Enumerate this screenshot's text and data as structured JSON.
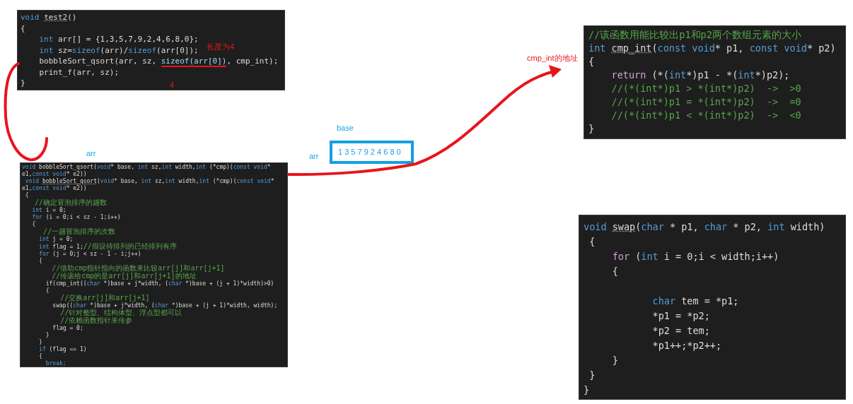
{
  "snippets": [
    {
      "lines": [
        {
          "tokens": [
            {
              "text": "void ",
              "kind": "kw"
            },
            {
              "text": "test2",
              "kind": "def"
            },
            {
              "text": "()",
              "kind": "pl"
            }
          ]
        },
        {
          "tokens": [
            {
              "text": "{",
              "kind": "pl"
            }
          ]
        },
        {
          "tokens": [
            {
              "text": "    int ",
              "kind": "kw"
            },
            {
              "text": "arr[] = {1,3,5,7,9,2,4,6,8,0};",
              "kind": "pl"
            }
          ]
        },
        {
          "tokens": [
            {
              "text": "    int ",
              "kind": "kw"
            },
            {
              "text": "sz=",
              "kind": "pl"
            },
            {
              "text": "sizeof",
              "kind": "kw"
            },
            {
              "text": "(arr)/",
              "kind": "pl"
            },
            {
              "text": "sizeof",
              "kind": "kw"
            },
            {
              "text": "(arr[0]);",
              "kind": "pl"
            }
          ]
        },
        {
          "tokens": [
            {
              "text": "    bobbleSort_qsort(arr, sz, ",
              "kind": "pl"
            },
            {
              "text": "sizeof(arr[0])",
              "kind": "mark"
            },
            {
              "text": ", cmp_int);",
              "kind": "pl"
            }
          ]
        },
        {
          "tokens": [
            {
              "text": "    print_f(arr, sz);",
              "kind": "pl"
            }
          ]
        },
        {
          "tokens": [
            {
              "text": "}",
              "kind": "pl"
            }
          ]
        }
      ]
    },
    {
      "lines": [
        {
          "tokens": [
            {
              "text": "void ",
              "kind": "kw"
            },
            {
              "text": "bobbleSort_qsort(",
              "kind": "pl"
            },
            {
              "text": "void",
              "kind": "kw"
            },
            {
              "text": "* base, ",
              "kind": "pl"
            },
            {
              "text": "int ",
              "kind": "kw"
            },
            {
              "text": "sz,",
              "kind": "pl"
            },
            {
              "text": "int ",
              "kind": "kw"
            },
            {
              "text": "width,",
              "kind": "pl"
            },
            {
              "text": "int ",
              "kind": "kw"
            },
            {
              "text": "(*cmp)(",
              "kind": "pl"
            },
            {
              "text": "const void",
              "kind": "kw"
            },
            {
              "text": "* e1,",
              "kind": "pl"
            },
            {
              "text": "const void",
              "kind": "kw"
            },
            {
              "text": "* e2))",
              "kind": "pl"
            }
          ]
        },
        {
          "tokens": [
            {
              "text": " void ",
              "kind": "kw"
            },
            {
              "text": "bobbleSort_qsort",
              "kind": "def"
            },
            {
              "text": "(",
              "kind": "pl"
            },
            {
              "text": "void",
              "kind": "kw"
            },
            {
              "text": "* base, ",
              "kind": "pl"
            },
            {
              "text": "int ",
              "kind": "kw"
            },
            {
              "text": "sz,",
              "kind": "pl"
            },
            {
              "text": "int ",
              "kind": "kw"
            },
            {
              "text": "width,",
              "kind": "pl"
            },
            {
              "text": "int ",
              "kind": "kw"
            },
            {
              "text": "(*cmp)(",
              "kind": "pl"
            },
            {
              "text": "const void",
              "kind": "kw"
            },
            {
              "text": "* e1,",
              "kind": "pl"
            },
            {
              "text": "const void",
              "kind": "kw"
            },
            {
              "text": "* e2))",
              "kind": "pl"
            }
          ]
        },
        {
          "tokens": [
            {
              "text": " {",
              "kind": "pl"
            }
          ]
        },
        {
          "tokens": [
            {
              "text": "   //确定冒泡排序的趟数",
              "kind": "cm"
            }
          ]
        },
        {
          "tokens": [
            {
              "text": "   int ",
              "kind": "kw"
            },
            {
              "text": "i = 0;",
              "kind": "pl"
            }
          ]
        },
        {
          "tokens": [
            {
              "text": "   for ",
              "kind": "kw"
            },
            {
              "text": "(i = 0;i < sz - 1;i++)",
              "kind": "pl"
            }
          ]
        },
        {
          "tokens": [
            {
              "text": "   {",
              "kind": "pl"
            }
          ]
        },
        {
          "tokens": [
            {
              "text": "     //一趟冒泡排序的次数",
              "kind": "cm"
            }
          ]
        },
        {
          "tokens": [
            {
              "text": "     int ",
              "kind": "kw"
            },
            {
              "text": "j = 0;",
              "kind": "pl"
            }
          ]
        },
        {
          "tokens": [
            {
              "text": "     int ",
              "kind": "kw"
            },
            {
              "text": "flag = 1;",
              "kind": "pl"
            },
            {
              "text": "//假设待排列的已经排列有序",
              "kind": "cm"
            }
          ]
        },
        {
          "tokens": [
            {
              "text": "     for ",
              "kind": "kw"
            },
            {
              "text": "(j = 0;j < sz - 1 - i;j++)",
              "kind": "pl"
            }
          ]
        },
        {
          "tokens": [
            {
              "text": "     {",
              "kind": "pl"
            }
          ]
        },
        {
          "tokens": [
            {
              "text": "       //借助cmp指针指向的函数来比较arr[j]和arr[j+1]",
              "kind": "cm"
            }
          ]
        },
        {
          "tokens": [
            {
              "text": "       //传递给cmp的是arr[j]和arr[j+1]的地址",
              "kind": "cm"
            }
          ]
        },
        {
          "tokens": [
            {
              "text": "       if(cmp_int((",
              "kind": "pl"
            },
            {
              "text": "char",
              "kind": "kw"
            },
            {
              "text": " *)base + j*width, (",
              "kind": "pl"
            },
            {
              "text": "char",
              "kind": "kw"
            },
            {
              "text": " *)base + (j + 1)*width)>0)",
              "kind": "pl"
            }
          ]
        },
        {
          "tokens": [
            {
              "text": "       {",
              "kind": "pl"
            }
          ]
        },
        {
          "tokens": [
            {
              "text": "         //交换arr[j]和arr[j+1]",
              "kind": "cm"
            }
          ]
        },
        {
          "tokens": [
            {
              "text": "         swap((",
              "kind": "pl"
            },
            {
              "text": "char",
              "kind": "kw"
            },
            {
              "text": " *)base + j*width, (",
              "kind": "pl"
            },
            {
              "text": "char",
              "kind": "kw"
            },
            {
              "text": " *)base + (j + 1)*width, width);",
              "kind": "pl"
            }
          ]
        },
        {
          "tokens": [
            {
              "text": "         //针对整型、结构体型、浮点型都可以",
              "kind": "cm"
            }
          ]
        },
        {
          "tokens": [
            {
              "text": "         //依赖函数指针来传参",
              "kind": "cm"
            }
          ]
        },
        {
          "tokens": [
            {
              "text": "         flag = 0;",
              "kind": "pl"
            }
          ]
        },
        {
          "tokens": [
            {
              "text": "       }",
              "kind": "pl"
            }
          ]
        },
        {
          "tokens": [
            {
              "text": "     }",
              "kind": "pl"
            }
          ]
        },
        {
          "tokens": [
            {
              "text": "     if ",
              "kind": "kw"
            },
            {
              "text": "(flag == 1)",
              "kind": "pl"
            }
          ]
        },
        {
          "tokens": [
            {
              "text": "     {",
              "kind": "pl"
            }
          ]
        },
        {
          "tokens": [
            {
              "text": "       break;",
              "kind": "kw"
            }
          ]
        }
      ]
    },
    {
      "lines": [
        {
          "tokens": [
            {
              "text": "//该函数用能比较出p1和p2两个数组元素的大小",
              "kind": "cm"
            }
          ]
        },
        {
          "tokens": [
            {
              "text": "int ",
              "kind": "kw"
            },
            {
              "text": "cmp_int",
              "kind": "def"
            },
            {
              "text": "(",
              "kind": "pl"
            },
            {
              "text": "const void",
              "kind": "kw"
            },
            {
              "text": "* p1, ",
              "kind": "pl"
            },
            {
              "text": "const void",
              "kind": "kw"
            },
            {
              "text": "* p2)",
              "kind": "pl"
            }
          ]
        },
        {
          "tokens": [
            {
              "text": "{",
              "kind": "pl"
            }
          ]
        },
        {
          "tokens": [
            {
              "text": "    return ",
              "kind": "ret"
            },
            {
              "text": "(*(",
              "kind": "pl"
            },
            {
              "text": "int",
              "kind": "kw"
            },
            {
              "text": "*)p1 - *(",
              "kind": "pl"
            },
            {
              "text": "int",
              "kind": "kw"
            },
            {
              "text": "*)p2);",
              "kind": "pl"
            }
          ]
        },
        {
          "tokens": [
            {
              "text": "    //(*(int*)p1 > *(int*)p2)  ->  >0",
              "kind": "cm"
            }
          ]
        },
        {
          "tokens": [
            {
              "text": "    //(*(int*)p1 = *(int*)p2)  ->  =0",
              "kind": "cm"
            }
          ]
        },
        {
          "tokens": [
            {
              "text": "    //(*(int*)p1 < *(int*)p2)  ->  <0",
              "kind": "cm"
            }
          ]
        },
        {
          "tokens": [
            {
              "text": "}",
              "kind": "pl"
            }
          ]
        }
      ]
    },
    {
      "lines": [
        {
          "gap": false,
          "tokens": [
            {
              "text": "void ",
              "kind": "kw"
            },
            {
              "text": "swap",
              "kind": "def"
            },
            {
              "text": "(",
              "kind": "pl"
            },
            {
              "text": "char",
              "kind": "kw"
            },
            {
              "text": " * p1, ",
              "kind": "pl"
            },
            {
              "text": "char",
              "kind": "kw"
            },
            {
              "text": " * p2, ",
              "kind": "pl"
            },
            {
              "text": "int ",
              "kind": "kw"
            },
            {
              "text": "width)",
              "kind": "pl"
            }
          ]
        },
        {
          "gap": false,
          "tokens": [
            {
              "text": " {",
              "kind": "pl"
            }
          ]
        },
        {
          "gap": false,
          "tokens": [
            {
              "text": "     for ",
              "kind": "ret"
            },
            {
              "text": "(",
              "kind": "pl"
            },
            {
              "text": "int ",
              "kind": "kw"
            },
            {
              "text": "i = 0;i < width;i++)",
              "kind": "pl"
            }
          ]
        },
        {
          "gap": false,
          "tokens": [
            {
              "text": "     {",
              "kind": "pl"
            }
          ]
        },
        {
          "gap": true,
          "tokens": [
            {
              "text": "            char ",
              "kind": "kw"
            },
            {
              "text": "tem = *p1;",
              "kind": "pl"
            }
          ]
        },
        {
          "gap": false,
          "tokens": [
            {
              "text": "            *p1 = *p2;",
              "kind": "pl"
            }
          ]
        },
        {
          "gap": false,
          "tokens": [
            {
              "text": "            *p2 = tem;",
              "kind": "pl"
            }
          ]
        },
        {
          "gap": false,
          "tokens": [
            {
              "text": "            *p1++;*p2++;",
              "kind": "pl"
            }
          ]
        },
        {
          "gap": false,
          "tokens": [
            {
              "text": "     }",
              "kind": "pl"
            }
          ]
        },
        {
          "gap": false,
          "tokens": [
            {
              "text": " }",
              "kind": "pl"
            }
          ]
        },
        {
          "gap": false,
          "tokens": [
            {
              "text": "}",
              "kind": "pl"
            }
          ]
        }
      ]
    }
  ],
  "annotations": [
    {
      "text": "长度为4",
      "kind": "red"
    },
    {
      "text": "4",
      "kind": "red"
    },
    {
      "text": "arr",
      "kind": "blue"
    },
    {
      "text": "base",
      "kind": "blue"
    },
    {
      "text": "arr",
      "kind": "blue"
    },
    {
      "text": "cmp_int的地址",
      "kind": "red"
    }
  ],
  "array_box": {
    "text": "1 3 5 7 9 2 4 6 8 0"
  }
}
